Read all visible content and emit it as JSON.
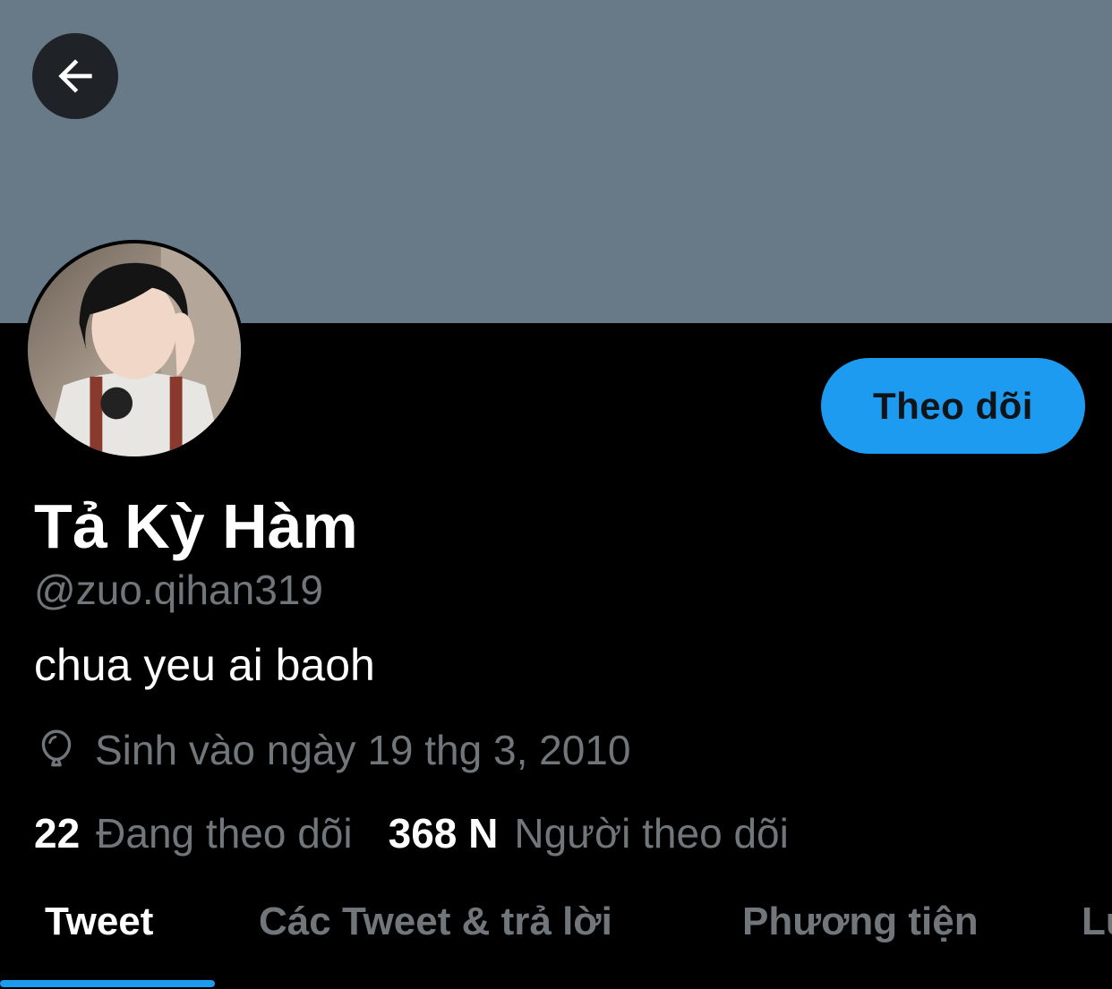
{
  "header": {
    "back_icon": "arrow-left-icon",
    "banner_color": "#687987"
  },
  "profile": {
    "name": "Tả Kỳ Hàm",
    "handle": "@zuo.qihan319",
    "bio": "chua yeu ai baoh",
    "birthday_icon": "balloon-icon",
    "birthday": "Sinh vào ngày 19 thg 3, 2010",
    "follow_label": "Theo dõi"
  },
  "stats": {
    "following_count": "22",
    "following_label": "Đang theo dõi",
    "followers_count": "368 N",
    "followers_label": "Người theo dõi"
  },
  "tabs": [
    {
      "label": "Tweet",
      "active": true
    },
    {
      "label": "Các Tweet & trả lời",
      "active": false
    },
    {
      "label": "Phương tiện",
      "active": false
    },
    {
      "label": "Lượt thích",
      "active": false
    }
  ],
  "colors": {
    "accent": "#1d9bf0",
    "secondary_text": "#71767b",
    "background": "#000000"
  }
}
